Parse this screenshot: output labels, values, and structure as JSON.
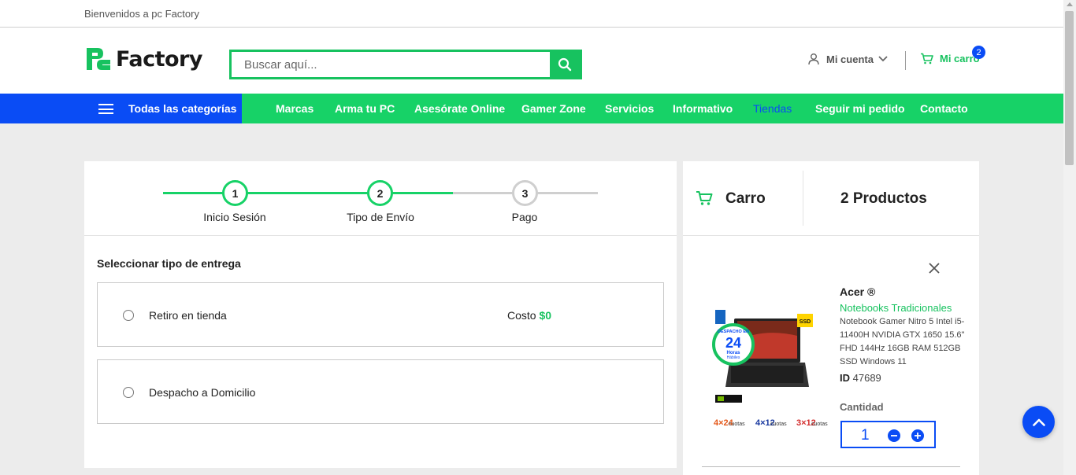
{
  "topbar": {
    "welcome": "Bienvenidos a pc Factory"
  },
  "header": {
    "logo_text": "Factory",
    "search_placeholder": "Buscar aquí...",
    "account_label": "Mi cuenta",
    "cart_label": "Mi carro",
    "cart_count": "2"
  },
  "nav": {
    "categories_label": "Todas las categorías",
    "items": [
      "Marcas",
      "Arma tu PC",
      "Asesórate Online",
      "Gamer Zone",
      "Servicios",
      "Informativo",
      "Tiendas",
      "Seguir mi pedido",
      "Contacto"
    ],
    "active_item": "Tiendas"
  },
  "checkout": {
    "steps": [
      {
        "number": "1",
        "label": "Inicio Sesión",
        "state": "done"
      },
      {
        "number": "2",
        "label": "Tipo de Envío",
        "state": "active"
      },
      {
        "number": "3",
        "label": "Pago",
        "state": "pending"
      }
    ],
    "section_title": "Seleccionar tipo de entrega",
    "options": [
      {
        "label": "Retiro en tienda",
        "cost_label": "Costo",
        "cost_value": "$0"
      },
      {
        "label": "Despacho a Domicilio"
      }
    ]
  },
  "cart": {
    "title": "Carro",
    "count_label": "2 Productos",
    "product": {
      "brand": "Acer ®",
      "category": "Notebooks Tradicionales",
      "name": "Notebook Gamer Nitro 5 Intel i5-11400H NVIDIA GTX 1650 15.6\" FHD 144Hz 16GB RAM 512GB SSD Windows 11",
      "id_label": "ID",
      "id_value": "47689",
      "quantity_label": "Cantidad",
      "quantity": "1",
      "badge_ssd": "SSD",
      "badge_despacho": "DESPACHO EN",
      "badge_hours": "24",
      "badge_horas": "Horas",
      "badge_habiles": "Hábiles",
      "cuotas": [
        "4×24",
        "4×12",
        "3×12"
      ],
      "cuotas_label": "cuotas"
    }
  },
  "colors": {
    "green": "#17c25f",
    "nav_green": "#17d267",
    "blue": "#0a4cf5",
    "background": "#ececec"
  }
}
